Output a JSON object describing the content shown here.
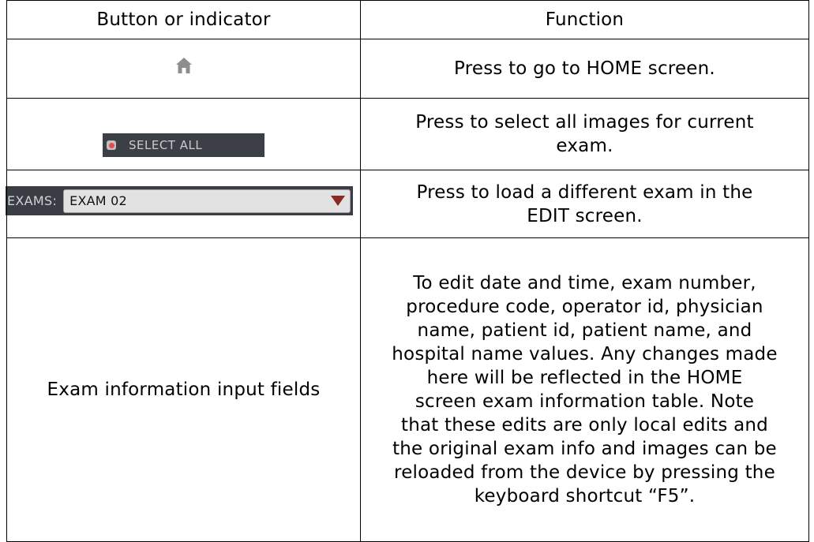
{
  "table": {
    "header": {
      "col1": "Button or indicator",
      "col2": "Function"
    },
    "rows": [
      {
        "icon": "home-icon",
        "function": "Press to go to HOME screen."
      },
      {
        "button_label": "SELECT ALL",
        "function_line1": "Press to select all images for current",
        "function_line2": "exam."
      },
      {
        "exams_label": "EXAMS:",
        "exams_value": "EXAM 02",
        "function_line1": "Press to load a different exam in the",
        "function_line2": "EDIT screen."
      },
      {
        "label": "Exam information input fields",
        "function_lines": [
          "To edit date and time, exam number,",
          "procedure code, operator id, physician",
          "name, patient id, patient name, and",
          "hospital name values. Any changes made",
          "here will be reflected in the HOME",
          "screen exam information table. Note",
          "that these edits are only local edits and",
          "the original exam info and images can be",
          "reloaded from the device by pressing the",
          "keyboard shortcut “F5”."
        ]
      }
    ]
  },
  "colors": {
    "home_icon": "#8e8e8e",
    "dark_bar": "#3a3d44",
    "select_dot": "#e74c4c",
    "exams_arrow": "#8b2a22"
  }
}
